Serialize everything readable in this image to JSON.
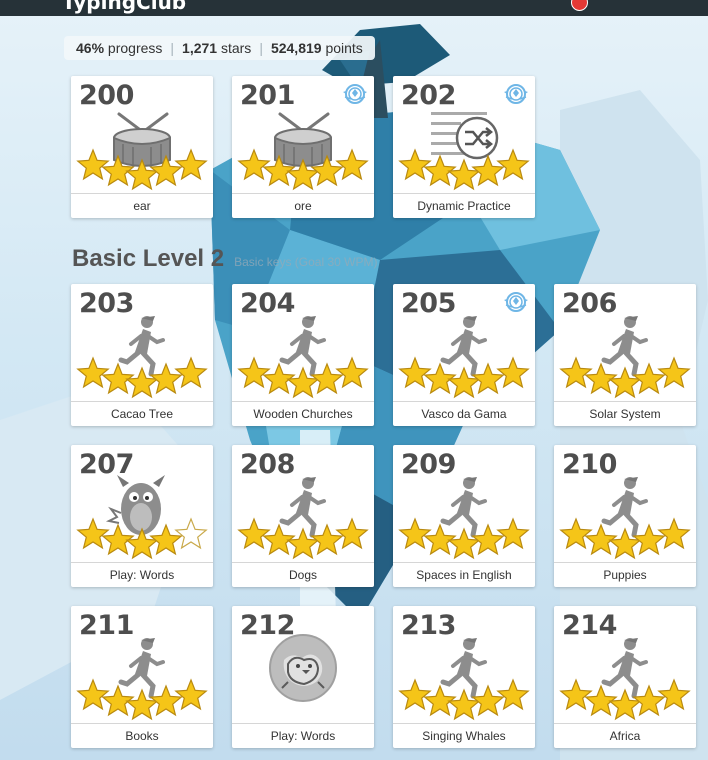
{
  "topbar": {
    "brand": "TypingClub"
  },
  "stats": {
    "progress": "46%",
    "progress_label": "progress",
    "stars": "1,271",
    "stars_label": "stars",
    "points": "524,819",
    "points_label": "points"
  },
  "section": {
    "title": "Basic Level 2",
    "subtitle": "Basic keys (Goal 30 WPM)"
  },
  "colors": {
    "star_fill": "#f5c518",
    "star_stroke": "#b98a10",
    "icon_gray": "#8d8d8d",
    "badge_blue": "#6fb6e6",
    "topbar": "#263238"
  },
  "lessons": [
    {
      "num": "200",
      "label": "ear",
      "icon": "drum-icon",
      "stars": 5,
      "badge": false
    },
    {
      "num": "201",
      "label": "ore",
      "icon": "drum-icon",
      "stars": 5,
      "badge": true
    },
    {
      "num": "202",
      "label": "Dynamic Practice",
      "icon": "shuffle-icon",
      "stars": 5,
      "badge": true
    },
    {
      "num": "203",
      "label": "Cacao Tree",
      "icon": "runner-icon",
      "stars": 5,
      "badge": false
    },
    {
      "num": "204",
      "label": "Wooden Churches",
      "icon": "runner-icon",
      "stars": 5,
      "badge": false
    },
    {
      "num": "205",
      "label": "Vasco da Gama",
      "icon": "runner-icon",
      "stars": 5,
      "badge": true
    },
    {
      "num": "206",
      "label": "Solar System",
      "icon": "runner-icon",
      "stars": 5,
      "badge": false
    },
    {
      "num": "207",
      "label": "Play: Words",
      "icon": "monster-icon",
      "stars": 4,
      "badge": false
    },
    {
      "num": "208",
      "label": "Dogs",
      "icon": "runner-icon",
      "stars": 5,
      "badge": false
    },
    {
      "num": "209",
      "label": "Spaces in English",
      "icon": "runner-icon",
      "stars": 5,
      "badge": false
    },
    {
      "num": "210",
      "label": "Puppies",
      "icon": "runner-icon",
      "stars": 5,
      "badge": false
    },
    {
      "num": "211",
      "label": "Books",
      "icon": "runner-icon",
      "stars": 5,
      "badge": false
    },
    {
      "num": "212",
      "label": "Play: Words",
      "icon": "chick-icon",
      "stars": 0,
      "badge": false
    },
    {
      "num": "213",
      "label": "Singing Whales",
      "icon": "runner-icon",
      "stars": 5,
      "badge": false
    },
    {
      "num": "214",
      "label": "Africa",
      "icon": "runner-icon",
      "stars": 5,
      "badge": false
    }
  ]
}
